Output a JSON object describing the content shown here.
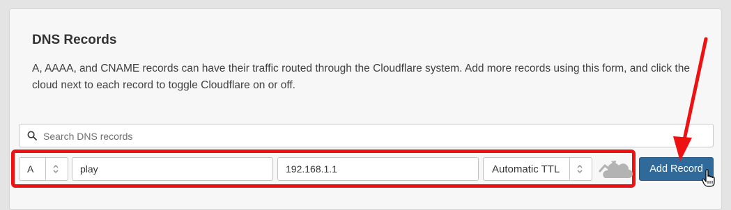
{
  "panel": {
    "title": "DNS Records",
    "description": "A, AAAA, and CNAME records can have their traffic routed through the Cloudflare system. Add more records using this form, and click the cloud next to each record to toggle Cloudflare on or off."
  },
  "search": {
    "placeholder": "Search DNS records",
    "icon": "search-icon"
  },
  "form": {
    "type_value": "A",
    "name_value": "play",
    "content_value": "192.168.1.1",
    "ttl_value": "Automatic TTL",
    "proxy_icon": "cloud-dns-only-icon",
    "add_button_label": "Add Record"
  },
  "annotations": {
    "highlight_color": "#ee1111",
    "arrow_color": "#ee1111"
  },
  "colors": {
    "button": "#2f6a9a",
    "cloud": "#b3b3b3"
  }
}
